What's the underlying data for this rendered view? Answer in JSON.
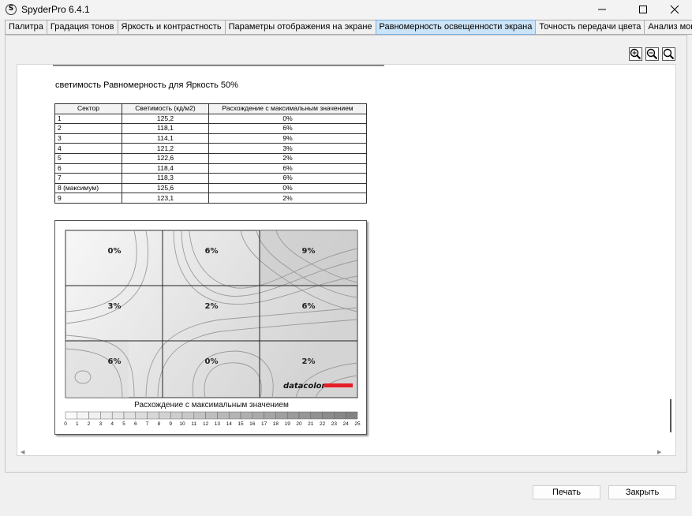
{
  "window": {
    "title": "SpyderPro 6.4.1",
    "icon_letter": "S"
  },
  "tabs": [
    {
      "label": "Палитра"
    },
    {
      "label": "Градация тонов"
    },
    {
      "label": "Яркость и контрастность"
    },
    {
      "label": "Параметры отображения на экране"
    },
    {
      "label": "Равномерность освещенности экрана",
      "active": true
    },
    {
      "label": "Точность передачи цвета"
    },
    {
      "label": "Анализ монитора"
    }
  ],
  "report": {
    "heading": "светимость Равномерность для Яркость 50%",
    "table": {
      "headers": [
        "Сектор",
        "Светимость (кд/м2)",
        "Расхождение с максимальным значением"
      ],
      "rows": [
        [
          "1",
          "125,2",
          "0%"
        ],
        [
          "2",
          "118,1",
          "6%"
        ],
        [
          "3",
          "114,1",
          "9%"
        ],
        [
          "4",
          "121,2",
          "3%"
        ],
        [
          "5",
          "122,6",
          "2%"
        ],
        [
          "6",
          "118,4",
          "6%"
        ],
        [
          "7",
          "118,3",
          "6%"
        ],
        [
          "8 (максимум)",
          "125,6",
          "0%"
        ],
        [
          "9",
          "123,1",
          "2%"
        ]
      ]
    },
    "map": {
      "cells": [
        "0%",
        "6%",
        "9%",
        "3%",
        "2%",
        "6%",
        "6%",
        "0%",
        "2%"
      ],
      "brand": "datacolor",
      "brand_color": "#e41e26",
      "scale_title": "Расхождение с максимальным значением",
      "scale_ticks": [
        "0",
        "1",
        "2",
        "3",
        "4",
        "5",
        "6",
        "7",
        "8",
        "9",
        "10",
        "11",
        "12",
        "13",
        "14",
        "15",
        "16",
        "17",
        "18",
        "19",
        "20",
        "21",
        "22",
        "23",
        "24",
        "25"
      ]
    }
  },
  "buttons": {
    "print": "Печать",
    "close": "Закрыть"
  }
}
